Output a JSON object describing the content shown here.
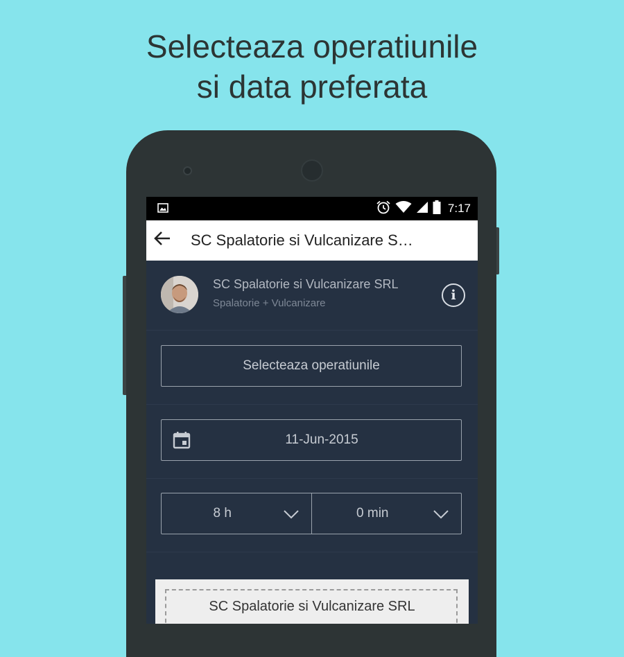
{
  "headline": {
    "line1": "Selecteaza operatiunile",
    "line2": "si data preferata"
  },
  "statusbar": {
    "left_icon": "image-notification-icon",
    "icons": [
      "alarm-icon",
      "wifi-icon",
      "signal-icon",
      "battery-icon"
    ],
    "time": "7:17"
  },
  "appbar": {
    "back_icon": "arrow-back-icon",
    "title": "SC Spalatorie si Vulcanizare S…"
  },
  "company": {
    "name": "SC Spalatorie si Vulcanizare SRL",
    "category": "Spalatorie + Vulcanizare",
    "info_icon": "info-icon"
  },
  "form": {
    "operations_button": "Selecteaza operatiunile",
    "date_icon": "calendar-icon",
    "date": "11-Jun-2015",
    "hour": "8 h",
    "minute": "0 min",
    "dropdown_icon": "chevron-down-icon"
  },
  "bottom_card": {
    "name": "SC Spalatorie si Vulcanizare SRL"
  },
  "colors": {
    "background": "#86e4ec",
    "phone": "#2d3435",
    "screen": "#253142",
    "appbar": "#ffffff"
  }
}
